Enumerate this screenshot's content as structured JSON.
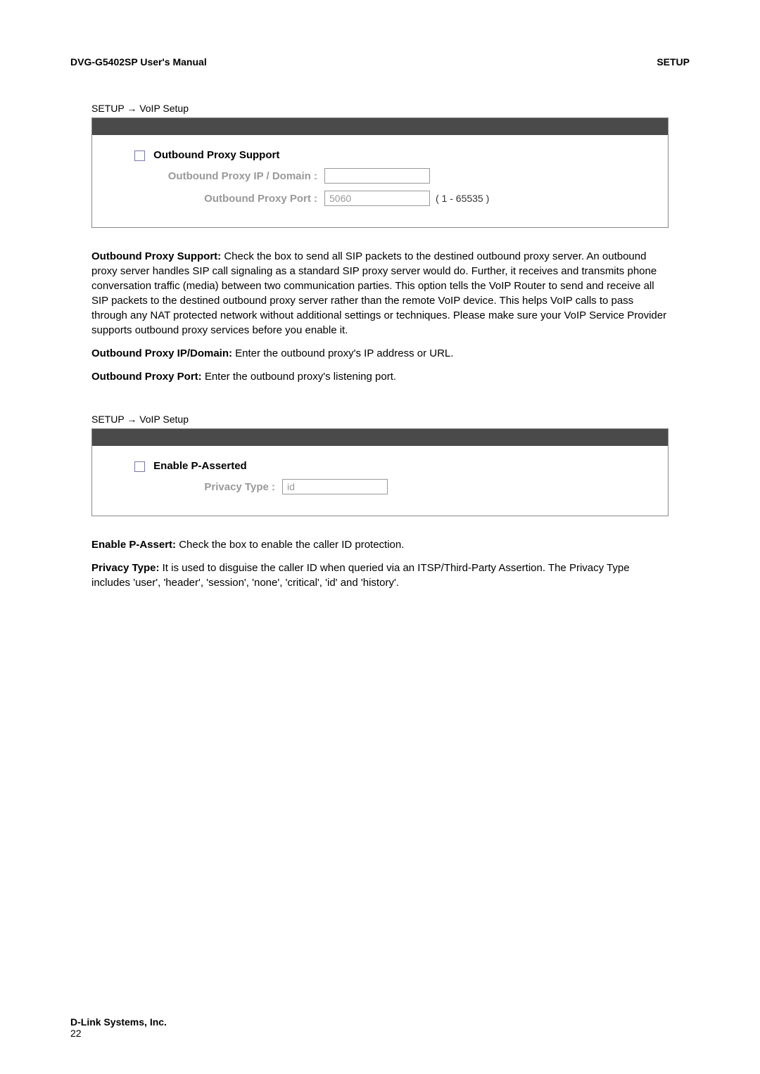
{
  "header": {
    "left": "DVG-G5402SP User's Manual",
    "right": "SETUP"
  },
  "section1": {
    "breadcrumb": "SETUP → VoIP Setup",
    "field1_label": "Outbound Proxy Support",
    "field2_label": "Outbound Proxy IP / Domain :",
    "field2_value": "",
    "field3_label": "Outbound Proxy Port :",
    "field3_value": "5060",
    "field3_hint": "( 1 - 65535 )"
  },
  "desc1": {
    "d1_bold": "Outbound Proxy Support: ",
    "d1_text": "Check the box to send all SIP packets to the destined outbound proxy server. An outbound proxy server handles SIP call signaling as a standard SIP proxy server would do. Further, it receives and transmits phone conversation traffic (media) between two communication parties. This option tells the VoIP Router to send and receive all SIP packets to the destined outbound proxy server rather than the remote VoIP device. This helps VoIP calls to pass through any NAT protected network without additional settings or techniques. Please make sure your VoIP Service Provider supports outbound proxy services before you enable it.",
    "d2_bold": "Outbound Proxy IP/Domain: ",
    "d2_text": "Enter the outbound proxy's IP address or URL.",
    "d3_bold": "Outbound Proxy Port: ",
    "d3_text": "Enter the outbound proxy's listening port."
  },
  "section2": {
    "breadcrumb": "SETUP → VoIP Setup",
    "field1_label": "Enable P-Asserted",
    "field2_label": "Privacy Type :",
    "field2_value": "id"
  },
  "desc2": {
    "d1_bold": "Enable P-Assert: ",
    "d1_text": "Check the box to enable the caller ID protection.",
    "d2_bold": "Privacy Type: ",
    "d2_text": "It is used to disguise the caller ID when queried via an ITSP/Third-Party Assertion. The Privacy Type includes 'user', 'header', 'session', 'none', 'critical', 'id' and 'history'."
  },
  "footer": {
    "company": "D-Link Systems, Inc.",
    "page": "22"
  }
}
